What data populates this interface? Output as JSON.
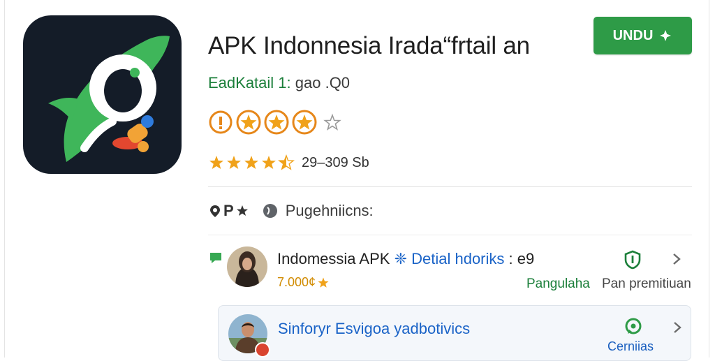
{
  "app": {
    "title": "APK Indonnesia Irada“frtail an",
    "developer": "EadKatail 1:",
    "version": "gao .Q0",
    "install_label": "UNDU",
    "count": "29–309 Sb"
  },
  "section": {
    "tag": "P",
    "label": "Pugehniicns:"
  },
  "items": [
    {
      "name": "Indomessia APK",
      "link": "❈ Detial hdoriks",
      "suffix": ": e9",
      "meta": "7.000¢",
      "action_label": "Pangulaha",
      "sub_label": "Pan premitiuan"
    },
    {
      "name": "Sinforyr Esvigoa yadbotivics",
      "action_label": "Cerniias"
    }
  ],
  "colors": {
    "brand_green": "#2e9b47",
    "link_blue": "#1a63c7",
    "star_orange": "#f0a21a",
    "icon_bg": "#141c28"
  },
  "icons": [
    "app-logo-icon",
    "download-icon",
    "star-icon",
    "chat-icon",
    "shield-icon",
    "whatsapp-icon",
    "chevron-right-icon"
  ]
}
